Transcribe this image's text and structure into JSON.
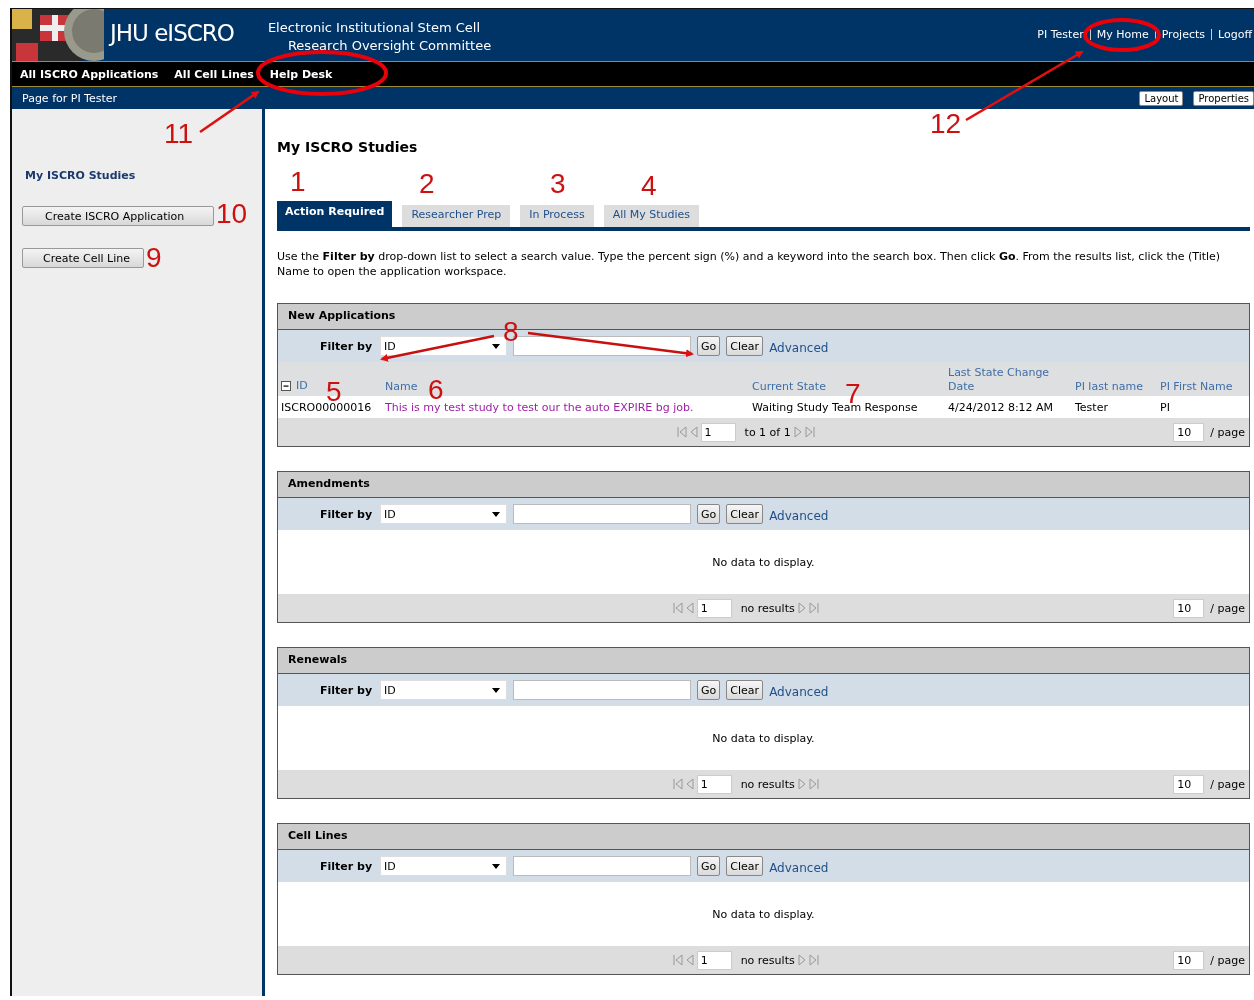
{
  "header": {
    "title": "JHU eISCRO",
    "subtitle_lines": [
      "Electronic Institutional Stem Cell",
      "Research Oversight Committee"
    ],
    "user_links": [
      "PI Tester",
      "My Home",
      "Projects",
      "Logoff"
    ]
  },
  "nav": [
    "All ISCRO Applications",
    "All Cell Lines",
    "Help Desk"
  ],
  "subbar": {
    "page_label": "Page for PI Tester",
    "buttons": [
      "Layout",
      "Properties"
    ]
  },
  "sidebar": {
    "heading": "My ISCRO Studies",
    "buttons": [
      "Create ISCRO Application",
      "Create Cell Line"
    ]
  },
  "main": {
    "title": "My ISCRO Studies",
    "tabs": [
      {
        "label": "Action Required",
        "selected": true
      },
      {
        "label": "Researcher Prep",
        "selected": false
      },
      {
        "label": "In Process",
        "selected": false
      },
      {
        "label": "All My Studies",
        "selected": false
      }
    ],
    "instructions": "Use the **Filter by** drop-down list to select a search value. Type the percent sign (%) and a keyword into the search box. Then click **Go**. From the results list, click the (Title) Name to open the application workspace.",
    "sections": [
      {
        "title": "New Applications",
        "filter_label": "Filter by",
        "filter_value": "ID",
        "buttons": [
          "Go",
          "Clear"
        ],
        "advanced": "Advanced",
        "columns": [
          "ID",
          "Name",
          "Current State",
          "Last State Change Date",
          "PI last name",
          "PI First Name"
        ],
        "rows": [
          [
            "ISCRO00000016",
            "This is my test study to test our the auto EXPIRE bg job.",
            "Waiting Study Team Response",
            "4/24/2012 8:12 AM",
            "Tester",
            "PI"
          ]
        ],
        "pager": {
          "page": "1",
          "summary": "to 1 of 1",
          "page_size": "10",
          "per_page": "/ page"
        }
      },
      {
        "title": "Amendments",
        "filter_label": "Filter by",
        "filter_value": "ID",
        "buttons": [
          "Go",
          "Clear"
        ],
        "advanced": "Advanced",
        "empty_text": "No data to display.",
        "pager": {
          "page": "1",
          "summary": "no results",
          "page_size": "10",
          "per_page": "/ page"
        }
      },
      {
        "title": "Renewals",
        "filter_label": "Filter by",
        "filter_value": "ID",
        "buttons": [
          "Go",
          "Clear"
        ],
        "advanced": "Advanced",
        "empty_text": "No data to display.",
        "pager": {
          "page": "1",
          "summary": "no results",
          "page_size": "10",
          "per_page": "/ page"
        }
      },
      {
        "title": "Cell Lines",
        "filter_label": "Filter by",
        "filter_value": "ID",
        "buttons": [
          "Go",
          "Clear"
        ],
        "advanced": "Advanced",
        "empty_text": "No data to display.",
        "pager": {
          "page": "1",
          "summary": "no results",
          "page_size": "10",
          "per_page": "/ page"
        }
      }
    ]
  },
  "annotations": [
    "1",
    "2",
    "3",
    "4",
    "5",
    "6",
    "7",
    "8",
    "9",
    "10",
    "11",
    "12"
  ]
}
